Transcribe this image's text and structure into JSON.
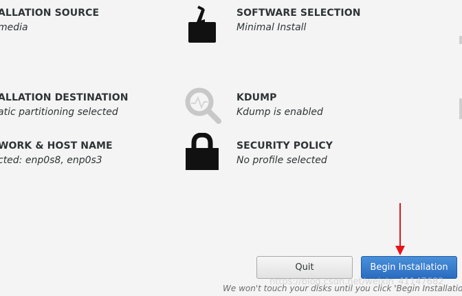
{
  "spokes": {
    "installation_source": {
      "title": "ALLATION SOURCE",
      "status": "media"
    },
    "software_selection": {
      "title": "SOFTWARE SELECTION",
      "status": "Minimal Install",
      "icon": "package-icon"
    },
    "installation_destination": {
      "title": "ALLATION DESTINATION",
      "status": "atic partitioning selected"
    },
    "kdump": {
      "title": "KDUMP",
      "status": "Kdump is enabled",
      "icon": "kdump-search-icon"
    },
    "network_host": {
      "title": "WORK & HOST NAME",
      "status": "cted: enp0s8, enp0s3"
    },
    "security_policy": {
      "title": "SECURITY POLICY",
      "status": "No profile selected",
      "icon": "lock-icon"
    }
  },
  "buttons": {
    "quit": "Quit",
    "begin_installation": "Begin Installation"
  },
  "footer": {
    "warning": "We won't touch your disks until you click 'Begin Installation'."
  },
  "watermark": "https://blog.csdn.net/weixin_41147682",
  "annotation": {
    "arrow_color": "#e8121a"
  },
  "colors": {
    "background": "#f4f4f4",
    "primary_button": "#3478cf",
    "text": "#2e3436"
  }
}
